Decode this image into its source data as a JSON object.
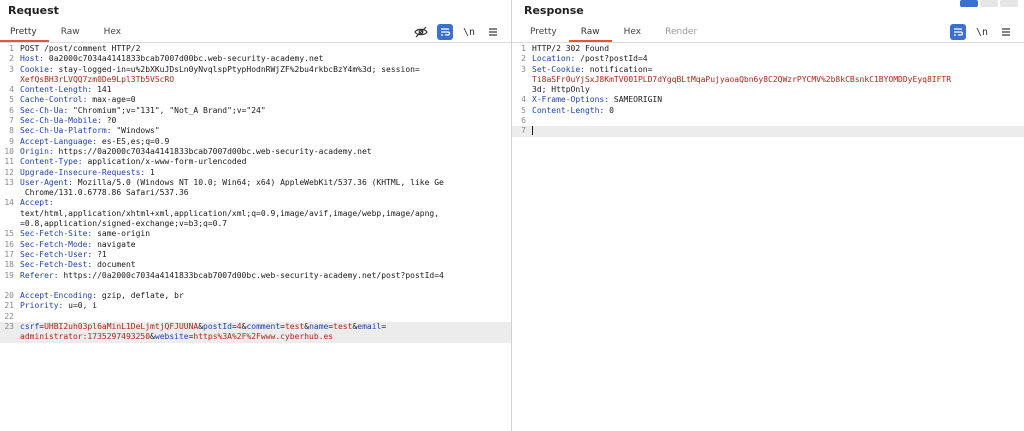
{
  "request": {
    "title": "Request",
    "tabs": [
      {
        "label": "Pretty",
        "active": true
      },
      {
        "label": "Raw",
        "active": false
      },
      {
        "label": "Hex",
        "active": false
      }
    ],
    "tools": {
      "hide_icon": "eye-slash-icon",
      "wrap_icon": "wrap-lines-icon",
      "newline_label": "\\n",
      "menu_icon": "hamburger-menu-icon"
    },
    "lines": [
      {
        "n": "1",
        "k": "",
        "v": "POST /post/comment HTTP/2"
      },
      {
        "n": "2",
        "k": "Host:",
        "v": " 0a2000c7034a4141833bcab7007d00bc.web-security-academy.net"
      },
      {
        "n": "3",
        "k": "Cookie:",
        "v": " stay-logged-in=u%2bXKuJDsLn0yNvqlspPtypHodnRWjZF%2bu4rkbcBzY4m%3d; session="
      },
      {
        "n": "",
        "k": "",
        "v": "XefQsBH3rLVQQ7zm0De9Lpl3Tb5VScRO",
        "red": true
      },
      {
        "n": "4",
        "k": "Content-Length:",
        "v": " 141"
      },
      {
        "n": "5",
        "k": "Cache-Control:",
        "v": " max-age=0"
      },
      {
        "n": "6",
        "k": "Sec-Ch-Ua:",
        "v": " \"Chromium\";v=\"131\", \"Not_A Brand\";v=\"24\""
      },
      {
        "n": "7",
        "k": "Sec-Ch-Ua-Mobile:",
        "v": " ?0"
      },
      {
        "n": "8",
        "k": "Sec-Ch-Ua-Platform:",
        "v": " \"Windows\""
      },
      {
        "n": "9",
        "k": "Accept-Language:",
        "v": " es-ES,es;q=0.9"
      },
      {
        "n": "10",
        "k": "Origin:",
        "v": " https://0a2000c7034a4141833bcab7007d00bc.web-security-academy.net"
      },
      {
        "n": "11",
        "k": "Content-Type:",
        "v": " application/x-www-form-urlencoded"
      },
      {
        "n": "12",
        "k": "Upgrade-Insecure-Requests:",
        "v": " 1"
      },
      {
        "n": "13",
        "k": "User-Agent:",
        "v": " Mozilla/5.0 (Windows NT 10.0; Win64; x64) AppleWebKit/537.36 (KHTML, like Ge"
      },
      {
        "n": "",
        "k": "",
        "v": " Chrome/131.0.6778.86 Safari/537.36"
      },
      {
        "n": "14",
        "k": "Accept:",
        "v": ""
      },
      {
        "n": "",
        "k": "",
        "v": "text/html,application/xhtml+xml,application/xml;q=0.9,image/avif,image/webp,image/apng,"
      },
      {
        "n": "",
        "k": "",
        "v": "=0.8,application/signed-exchange;v=b3;q=0.7"
      },
      {
        "n": "15",
        "k": "Sec-Fetch-Site:",
        "v": " same-origin"
      },
      {
        "n": "16",
        "k": "Sec-Fetch-Mode:",
        "v": " navigate"
      },
      {
        "n": "17",
        "k": "Sec-Fetch-User:",
        "v": " ?1"
      },
      {
        "n": "18",
        "k": "Sec-Fetch-Dest:",
        "v": " document"
      },
      {
        "n": "19",
        "k": "Referer:",
        "v": " https://0a2000c7034a4141833bcab7007d00bc.web-security-academy.net/post?postId=4"
      },
      {
        "n": "",
        "k": "",
        "v": ""
      },
      {
        "n": "20",
        "k": "Accept-Encoding:",
        "v": " gzip, deflate, br"
      },
      {
        "n": "21",
        "k": "Priority:",
        "v": " u=0, i"
      },
      {
        "n": "22",
        "k": "",
        "v": ""
      },
      {
        "n": "23",
        "k": "",
        "v": "",
        "body": true
      },
      {
        "n": "",
        "k": "",
        "v": "",
        "body2": true
      }
    ],
    "body_line_1": {
      "csrf_key": "csrf",
      "csrf_val": "UHBI2uh03pl6aMinL1DeLjmtjQFJUUNA",
      "postId_key": "postId",
      "postId_val": "4",
      "comment_key": "comment",
      "comment_val": "test",
      "name_key": "name",
      "name_val": "test",
      "email_key": "email"
    },
    "body_line_2": {
      "email_val": "administrator:1735297493250",
      "website_key": "website",
      "website_val": "https%3A%2F%2Fwww.cyberhub.es"
    }
  },
  "response": {
    "title": "Response",
    "tabs": [
      {
        "label": "Pretty",
        "active": false
      },
      {
        "label": "Raw",
        "active": true
      },
      {
        "label": "Hex",
        "active": false
      },
      {
        "label": "Render",
        "active": false,
        "disabled": true
      }
    ],
    "tools": {
      "wrap_icon": "wrap-lines-icon",
      "newline_label": "\\n",
      "menu_icon": "hamburger-menu-icon"
    },
    "lines": [
      {
        "n": "1",
        "k": "",
        "v": "HTTP/2 302 Found"
      },
      {
        "n": "2",
        "k": "Location:",
        "v": " /post?postId=4"
      },
      {
        "n": "3",
        "k": "Set-Cookie:",
        "v": " notification="
      },
      {
        "n": "",
        "k": "",
        "v": "Ti8aSFr0uYjSxJ8KmTV001PLD7dYgqBLtMqaPujyaoaQbn6y8C2QWzrPYCMV%2b8kCBsnkC1BYOMDDyEyq8IFTR",
        "red": true
      },
      {
        "n": "",
        "k": "",
        "v": "3d; HttpOnly"
      },
      {
        "n": "4",
        "k": "X-Frame-Options:",
        "v": " SAMEORIGIN"
      },
      {
        "n": "5",
        "k": "Content-Length:",
        "v": " 0"
      },
      {
        "n": "6",
        "k": "",
        "v": ""
      },
      {
        "n": "7",
        "k": "",
        "v": "",
        "caret": true
      }
    ]
  }
}
